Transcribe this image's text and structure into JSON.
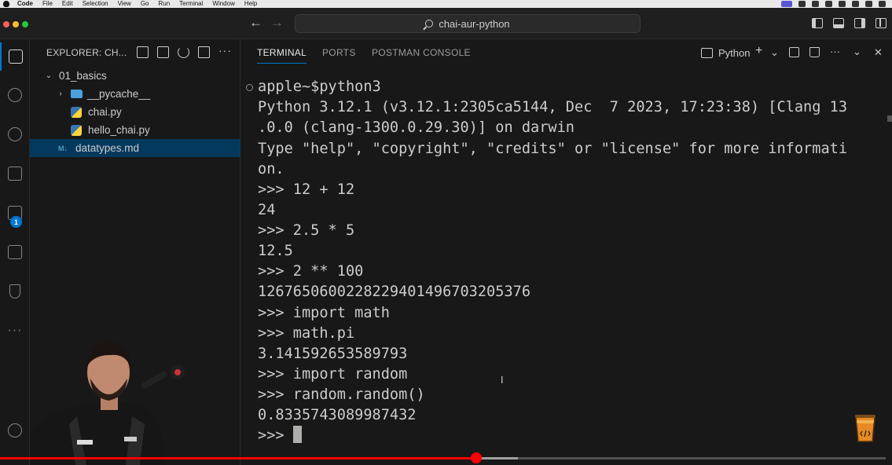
{
  "menubar": {
    "app": "Code",
    "items": [
      "File",
      "Edit",
      "Selection",
      "View",
      "Go",
      "Run",
      "Terminal",
      "Window",
      "Help"
    ]
  },
  "titlebar": {
    "search_text": "chai-aur-python"
  },
  "activity": {
    "extensions_badge": "1",
    "more": "···"
  },
  "explorer": {
    "title": "EXPLORER: CH...",
    "tree": [
      {
        "label": "01_basics",
        "type": "folder-open"
      },
      {
        "label": "__pycache__",
        "type": "folder"
      },
      {
        "label": "chai.py",
        "type": "python"
      },
      {
        "label": "hello_chai.py",
        "type": "python"
      },
      {
        "label": "datatypes.md",
        "type": "markdown"
      }
    ],
    "md_icon": "M↓"
  },
  "panel": {
    "tabs": [
      "TERMINAL",
      "PORTS",
      "POSTMAN CONSOLE"
    ],
    "active_tab": "TERMINAL",
    "terminal_name": "Python",
    "add": "+",
    "chevron": "⌄",
    "more": "···",
    "close": "✕"
  },
  "terminal": {
    "lines": [
      "apple~$python3",
      "Python 3.12.1 (v3.12.1:2305ca5144, Dec  7 2023, 17:23:38) [Clang 13",
      ".0.0 (clang-1300.0.29.30)] on darwin",
      "Type \"help\", \"copyright\", \"credits\" or \"license\" for more informati",
      "on.",
      ">>> 12 + 12",
      "24",
      ">>> 2.5 * 5",
      "12.5",
      ">>> 2 ** 100",
      "1267650600228229401496703205376",
      ">>> import math",
      ">>> math.pi",
      "3.141592653589793",
      ">>> import random",
      ">>> random.random()",
      "0.8335743089987432"
    ],
    "current_prompt": ">>> "
  },
  "video": {
    "progress_fraction": 0.538,
    "buffer_fraction": 0.585
  },
  "colors": {
    "accent": "#0078d4",
    "progress": "#ff0000",
    "background": "#181818"
  }
}
